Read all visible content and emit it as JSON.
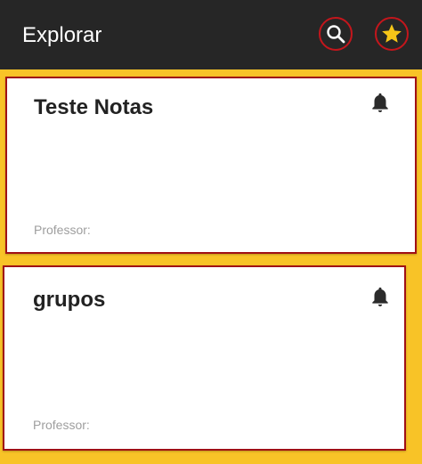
{
  "appbar": {
    "title": "Explorar",
    "search_icon": "search-icon",
    "favorites_icon": "star-icon",
    "star_color": "#f5c518",
    "highlight_color": "#c4161c"
  },
  "cards": [
    {
      "title": "Teste Notas",
      "professor_label": "Professor:",
      "icon": "bell-icon"
    },
    {
      "title": "grupos",
      "professor_label": "Professor:",
      "icon": "bell-icon"
    }
  ],
  "colors": {
    "appbar_bg": "#262626",
    "page_bg": "#f8c327",
    "card_bg": "#ffffff"
  }
}
